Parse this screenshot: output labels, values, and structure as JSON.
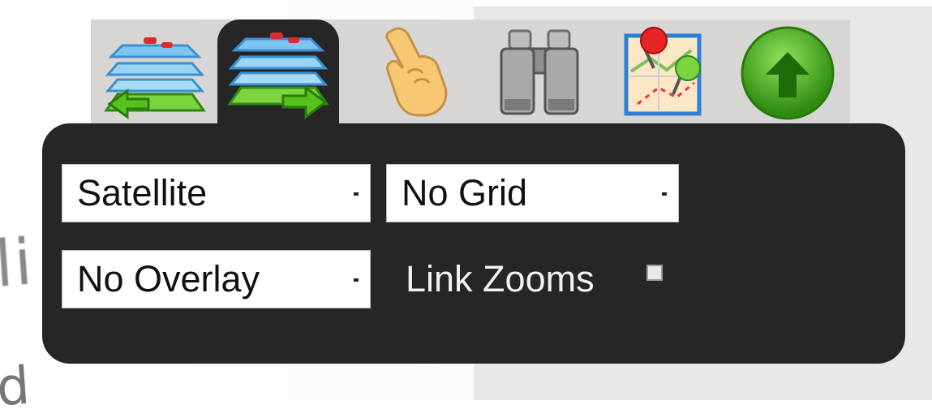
{
  "background": {
    "left_text_1": "li",
    "left_text_2": "d"
  },
  "toolbar": {
    "tools": [
      {
        "icon": "layers-back-icon",
        "active": false
      },
      {
        "icon": "layers-forward-icon",
        "active": true
      },
      {
        "icon": "pointing-hand-icon",
        "active": false
      },
      {
        "icon": "binoculars-icon",
        "active": false
      },
      {
        "icon": "map-pins-icon",
        "active": false
      },
      {
        "icon": "up-arrow-circle-icon",
        "active": false
      }
    ]
  },
  "panel": {
    "map_type_select": {
      "value": "Satellite"
    },
    "grid_select": {
      "value": "No Grid"
    },
    "overlay_select": {
      "value": "No Overlay"
    },
    "link_zooms": {
      "label": "Link Zooms",
      "checked": false
    }
  },
  "colors": {
    "panel_bg": "#262626",
    "toolbar_bg": "#d7d6d4",
    "right_bg": "#e9e8e6",
    "green_accent": "#3aa60c",
    "red_pin": "#d61f1f"
  }
}
